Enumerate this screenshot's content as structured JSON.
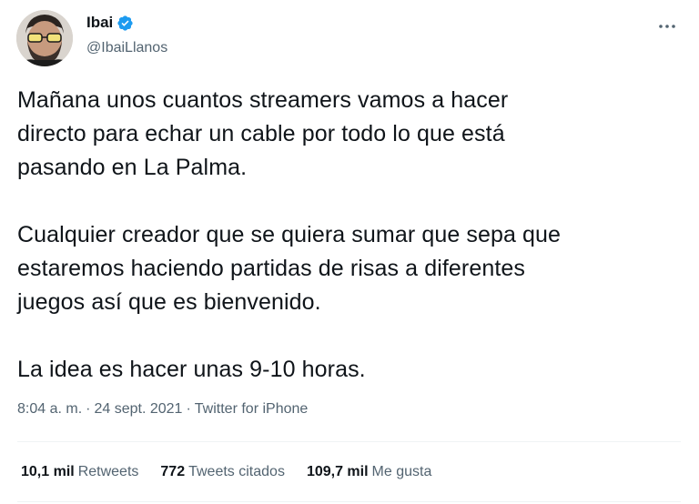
{
  "author": {
    "display_name": "Ibai",
    "handle": "@IbaiLlanos",
    "verified": true,
    "avatar_icon": "avatar-glasses"
  },
  "more_icon": "ellipsis-icon",
  "tweet_text": "Mañana unos cuantos streamers vamos a hacer\ndirecto para echar un cable por todo lo que está\npasando en La Palma.\n\nCualquier creador que se quiera sumar que sepa que\nestaremos haciendo partidas de risas a diferentes\njuegos así que es bienvenido.\n\nLa idea es hacer unas 9-10 horas.",
  "meta": {
    "time": "8:04 a. m.",
    "separator": "·",
    "date": "24 sept. 2021",
    "source": "Twitter for iPhone"
  },
  "stats": {
    "retweets_count": "10,1 mil",
    "retweets_label": "Retweets",
    "quotes_count": "772",
    "quotes_label": "Tweets citados",
    "likes_count": "109,7 mil",
    "likes_label": "Me gusta"
  },
  "colors": {
    "text": "#0f1419",
    "secondary": "#536471",
    "verified": "#1d9bf0",
    "divider": "#eff3f4"
  }
}
